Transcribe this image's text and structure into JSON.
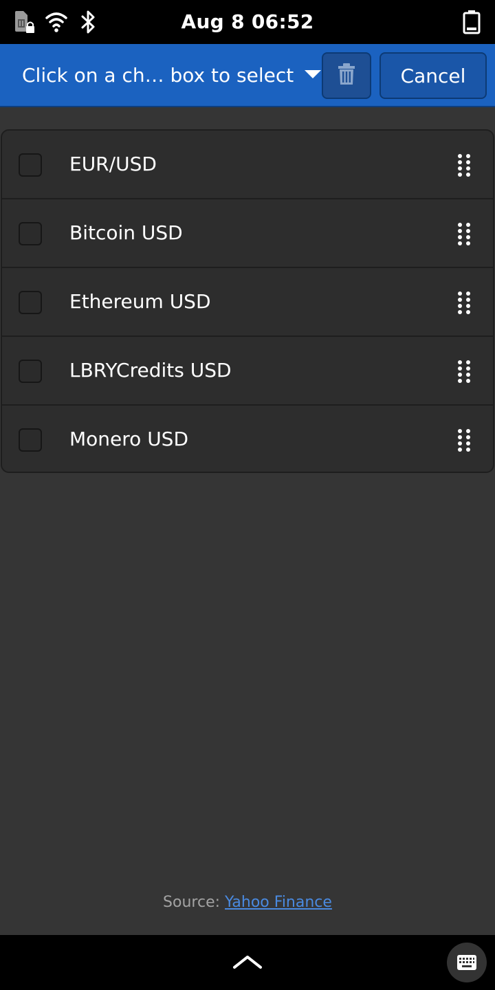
{
  "status_bar": {
    "clock": "Aug 8  06:52",
    "icons": [
      "sim-locked-icon",
      "wifi-icon",
      "bluetooth-icon",
      "battery-icon"
    ]
  },
  "header": {
    "title": "Click on a ch… box to select",
    "delete_icon": "trash-icon",
    "cancel_label": "Cancel",
    "accent_color": "#1b62c0"
  },
  "list": {
    "items": [
      {
        "label": "EUR/USD",
        "checked": false
      },
      {
        "label": "Bitcoin USD",
        "checked": false
      },
      {
        "label": "Ethereum USD",
        "checked": false
      },
      {
        "label": "LBRYCredits USD",
        "checked": false
      },
      {
        "label": "Monero USD",
        "checked": false
      }
    ]
  },
  "footer": {
    "prefix": "Source: ",
    "link_text": "Yahoo Finance"
  },
  "nav": {
    "up_icon": "chevron-up-icon",
    "keyboard_icon": "keyboard-icon"
  }
}
